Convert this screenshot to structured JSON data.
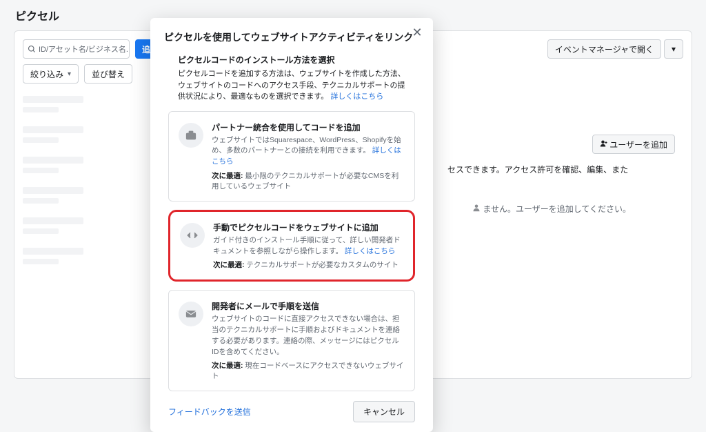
{
  "page": {
    "title": "ピクセル",
    "search_placeholder": "ID/アセット名/ビジネス名...",
    "add_button_visible_text": "追",
    "open_in_event_manager": "イベントマネージャで開く",
    "filter_label": "絞り込み",
    "sort_label": "並び替え"
  },
  "right_panel": {
    "add_user_label": "ユーザーを追加",
    "line1": "セスできます。アクセス許可を確認、編集、また",
    "line2": "ません。ユーザーを追加してください。"
  },
  "modal": {
    "title": "ピクセルを使用してウェブサイトアクティビティをリンク",
    "sub_title": "ピクセルコードのインストール方法を選択",
    "sub_desc_a": "ピクセルコードを追加する方法は、ウェブサイトを作成した方法、ウェブサイトのコードへのアクセス手段、テクニカルサポートの提供状況により、最適なものを選択できます。",
    "sub_link": "詳しくはこちら",
    "options": [
      {
        "title": "パートナー統合を使用してコードを追加",
        "desc_a": "ウェブサイトではSquarespace、WordPress、Shopifyを始め、多数のパートナーとの接続を利用できます。",
        "desc_link": "詳しくはこちら",
        "best_label": "次に最適:",
        "best_text": "最小限のテクニカルサポートが必要なCMSを利用しているウェブサイト"
      },
      {
        "title": "手動でピクセルコードをウェブサイトに追加",
        "desc_a": "ガイド付きのインストール手順に従って、詳しい開発者ドキュメントを参照しながら操作します。",
        "desc_link": "詳しくはこちら",
        "best_label": "次に最適:",
        "best_text": "テクニカルサポートが必要なカスタムのサイト"
      },
      {
        "title": "開発者にメールで手順を送信",
        "desc_a": "ウェブサイトのコードに直接アクセスできない場合は、担当のテクニカルサポートに手順およびドキュメントを連絡する必要があります。連絡の際、メッセージにはピクセルIDを含めてください。",
        "desc_link": "",
        "best_label": "次に最適:",
        "best_text": "現在コードベースにアクセスできないウェブサイト"
      }
    ],
    "feedback": "フィードバックを送信",
    "cancel": "キャンセル"
  }
}
